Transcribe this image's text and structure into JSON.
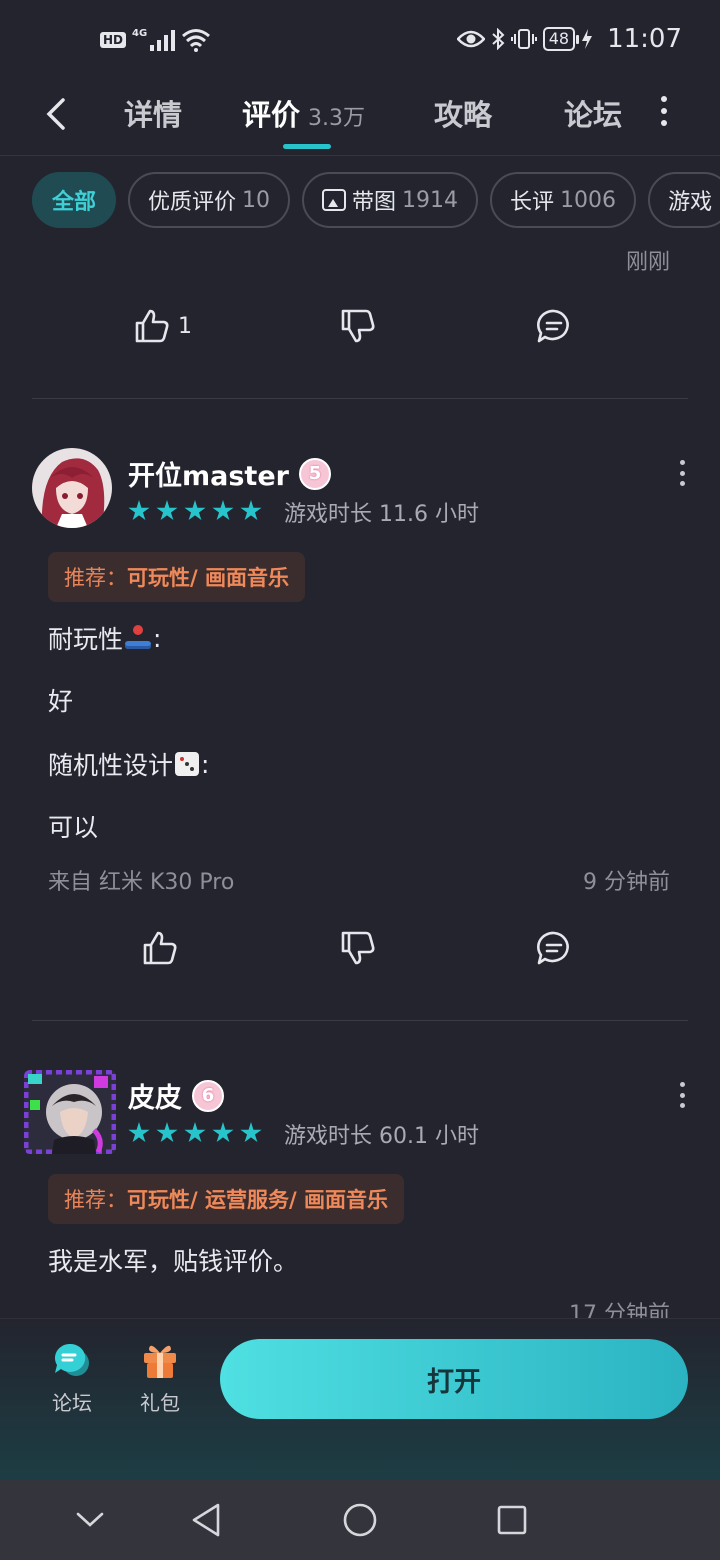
{
  "status_bar": {
    "hd": "HD",
    "signal_tag": "4G",
    "wifi_tag": "6",
    "battery": "48",
    "time": "11:07"
  },
  "nav": {
    "tabs": [
      {
        "label": "详情"
      },
      {
        "label": "评价",
        "count": "3.3万"
      },
      {
        "label": "攻略"
      },
      {
        "label": "论坛"
      }
    ]
  },
  "filters": {
    "chips": [
      {
        "label": "全部",
        "count": ""
      },
      {
        "label": "优质评价",
        "count": "10"
      },
      {
        "label": "带图",
        "count": "1914"
      },
      {
        "label": "长评",
        "count": "1006"
      },
      {
        "label": "游戏",
        "count": ""
      }
    ]
  },
  "previous_review": {
    "time": "刚刚",
    "likes": "1"
  },
  "reviews": [
    {
      "user": "开位master",
      "level": "5",
      "stars": 5,
      "playtime": "游戏时长 11.6 小时",
      "rec_label": "推荐：",
      "rec_tags": "可玩性/ 画面音乐",
      "lines": [
        "耐玩性",
        ":",
        "好",
        "随机性设计",
        ":",
        "可以"
      ],
      "device": "来自 红米 K30 Pro",
      "time": "9 分钟前",
      "likes": ""
    },
    {
      "user": "皮皮",
      "level": "6",
      "stars": 5,
      "playtime": "游戏时长 60.1 小时",
      "rec_label": "推荐：",
      "rec_tags": "可玩性/ 运营服务/ 画面音乐",
      "lines": [
        "我是水军，贴钱评价。"
      ],
      "time": "17 分钟前"
    }
  ],
  "bottom_bar": {
    "forum_label": "论坛",
    "gift_label": "礼包",
    "open_label": "打开"
  },
  "colors": {
    "accent": "#27c4cb",
    "background": "#23242e",
    "recommend_text": "#f0895a",
    "level_badge": "#f7c6d6"
  }
}
